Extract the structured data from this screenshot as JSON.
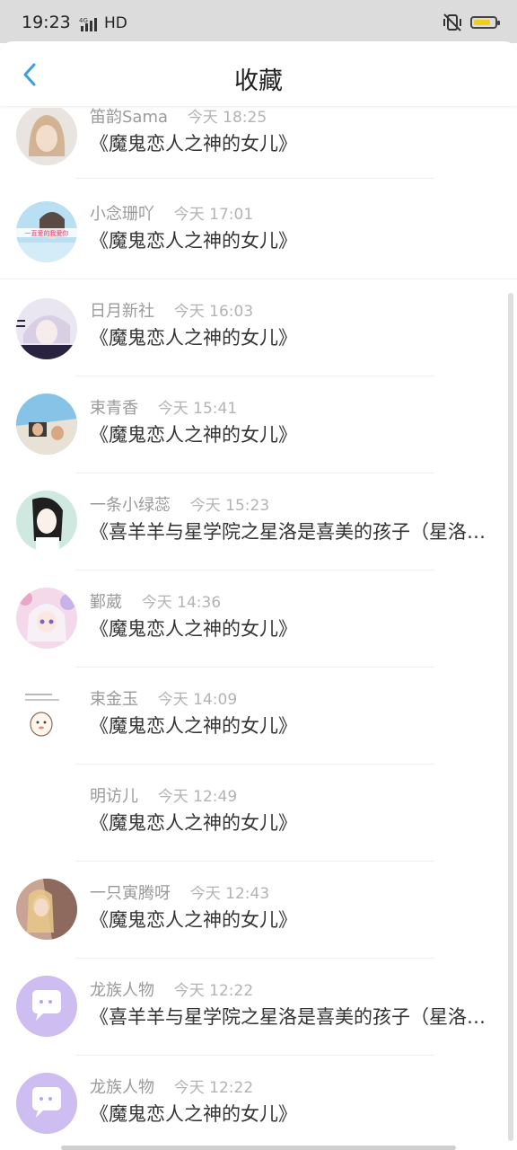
{
  "status_bar": {
    "time": "19:23",
    "network": "4G",
    "hd": "HD",
    "battery_level": 0.7,
    "battery_color": "#f2cd1c"
  },
  "header": {
    "title": "收藏",
    "back_icon": "chevron-left-icon",
    "accent": "#3aa0d8"
  },
  "items": [
    {
      "user": "笛韵Sama",
      "time": "今天 18:25",
      "title": "《魔鬼恋人之神的女儿》",
      "avatar": "photo"
    },
    {
      "user": "小念珊吖",
      "time": "今天 17:01",
      "title": "《魔鬼恋人之神的女儿》",
      "avatar": "photo",
      "avatar_caption": "一直爱的我爱你"
    },
    {
      "user": "日月新社",
      "time": "今天 16:03",
      "title": "《魔鬼恋人之神的女儿》",
      "avatar": "photo"
    },
    {
      "user": "束青香",
      "time": "今天 15:41",
      "title": "《魔鬼恋人之神的女儿》",
      "avatar": "photo"
    },
    {
      "user": "一条小绿蕊",
      "time": "今天 15:23",
      "title": "《喜羊羊与星学院之星洛是喜美的孩子（星洛…",
      "avatar": "photo"
    },
    {
      "user": "鄞葳",
      "time": "今天 14:36",
      "title": "《魔鬼恋人之神的女儿》",
      "avatar": "photo"
    },
    {
      "user": "束金玉",
      "time": "今天 14:09",
      "title": "《魔鬼恋人之神的女儿》",
      "avatar": "sketch"
    },
    {
      "user": "明访儿",
      "time": "今天 12:49",
      "title": "《魔鬼恋人之神的女儿》",
      "avatar": "none"
    },
    {
      "user": "一只寅腾呀",
      "time": "今天 12:43",
      "title": "《魔鬼恋人之神的女儿》",
      "avatar": "photo"
    },
    {
      "user": "龙族人物",
      "time": "今天 12:22",
      "title": "《喜羊羊与星学院之星洛是喜美的孩子（星洛…",
      "avatar": "default"
    },
    {
      "user": "龙族人物",
      "time": "今天 12:22",
      "title": "《魔鬼恋人之神的女儿》",
      "avatar": "default"
    }
  ]
}
